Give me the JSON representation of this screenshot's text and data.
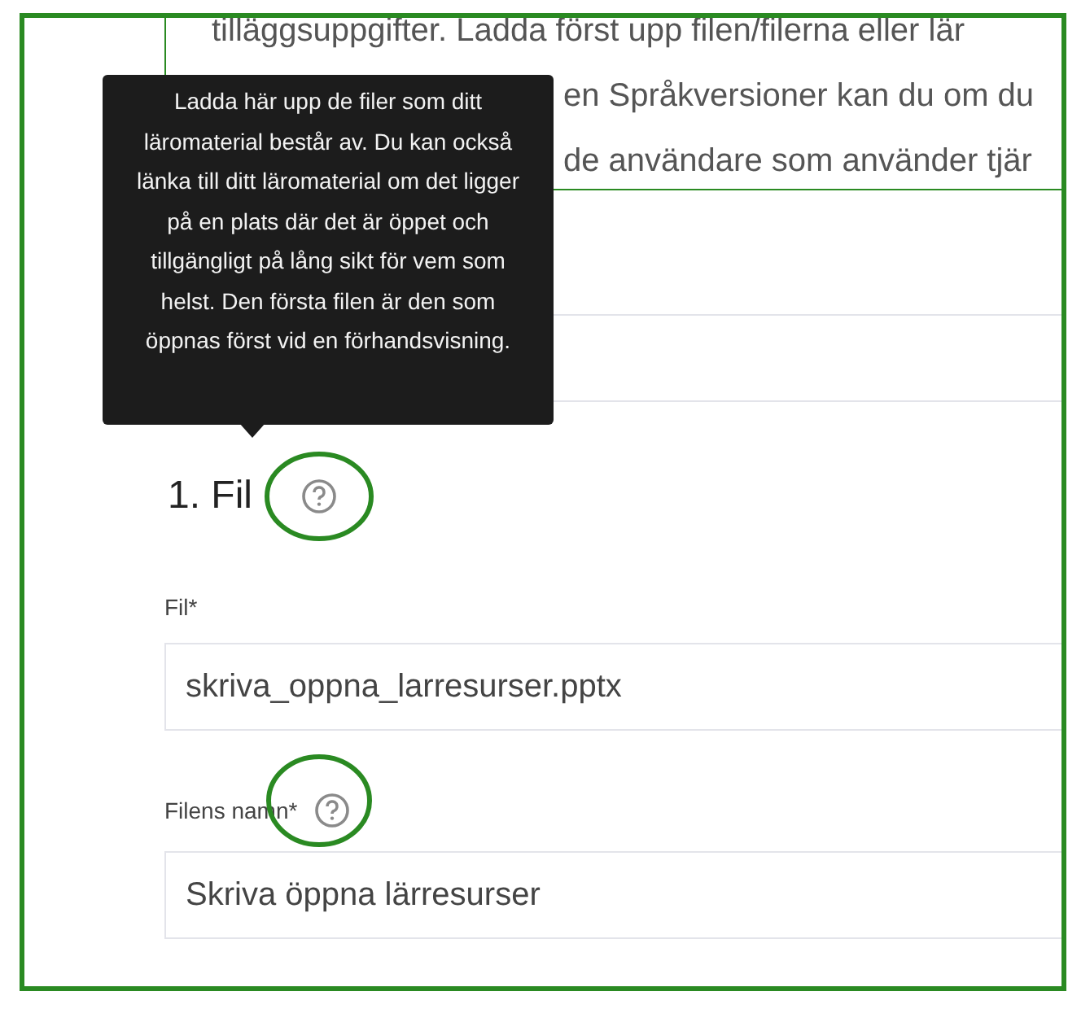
{
  "info_box": {
    "lines": [
      {
        "text": "tilläggsuppgifter. Ladda först upp filen/filerna eller lär",
        "covered": false
      },
      {
        "text": "en Språkversioner kan du om du",
        "covered": true
      },
      {
        "text": "de användare som använder tjär",
        "covered": true
      }
    ]
  },
  "tooltip": {
    "text": "Ladda här upp de filer som ditt läromaterial består av. Du kan också länka till ditt läromaterial om det ligger på en plats där det är öppet och tillgängligt på lång sikt för vem som helst. Den första filen är den som öppnas först vid en förhandsvisning."
  },
  "section": {
    "title": "1. Fil",
    "help_highlighted": true,
    "fields": [
      {
        "label": "Fil*",
        "value": "skriva_oppna_larresurser.pptx",
        "help": false,
        "highlighted": false
      },
      {
        "label": "Filens namn*",
        "value": "Skriva öppna lärresurser",
        "help": true,
        "highlighted": true
      }
    ]
  }
}
